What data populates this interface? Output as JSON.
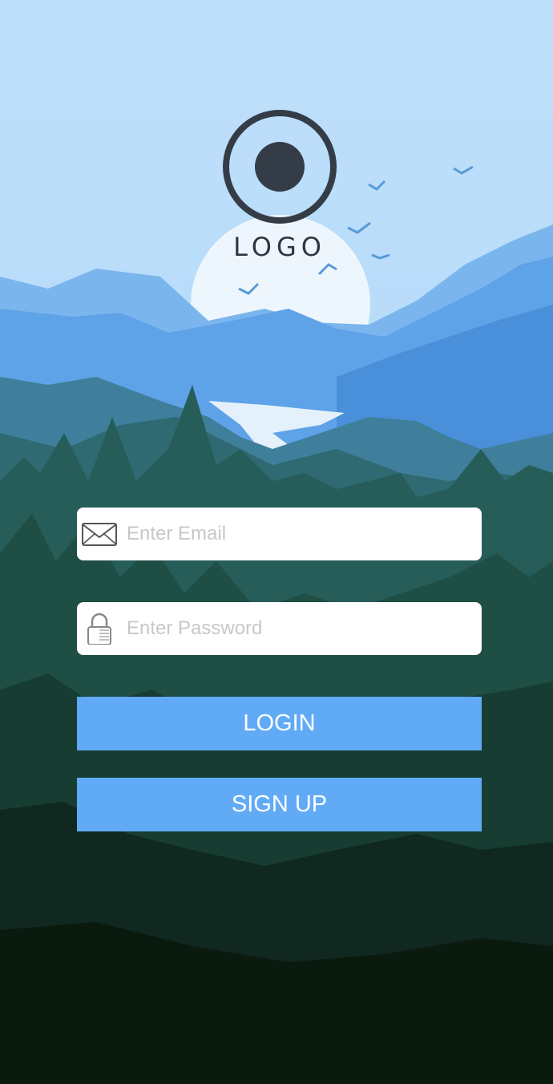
{
  "logo": {
    "text": "LOGO"
  },
  "form": {
    "email": {
      "placeholder": "Enter Email",
      "value": "",
      "icon": "mail-icon"
    },
    "password": {
      "placeholder": "Enter Password",
      "value": "",
      "icon": "lock-icon"
    }
  },
  "buttons": {
    "login_label": "LOGIN",
    "signup_label": "SIGN UP"
  },
  "colors": {
    "button": "#61abf6",
    "logo": "#343c47",
    "sky": "#b9def9",
    "forest_dark": "#0b1a0f"
  }
}
